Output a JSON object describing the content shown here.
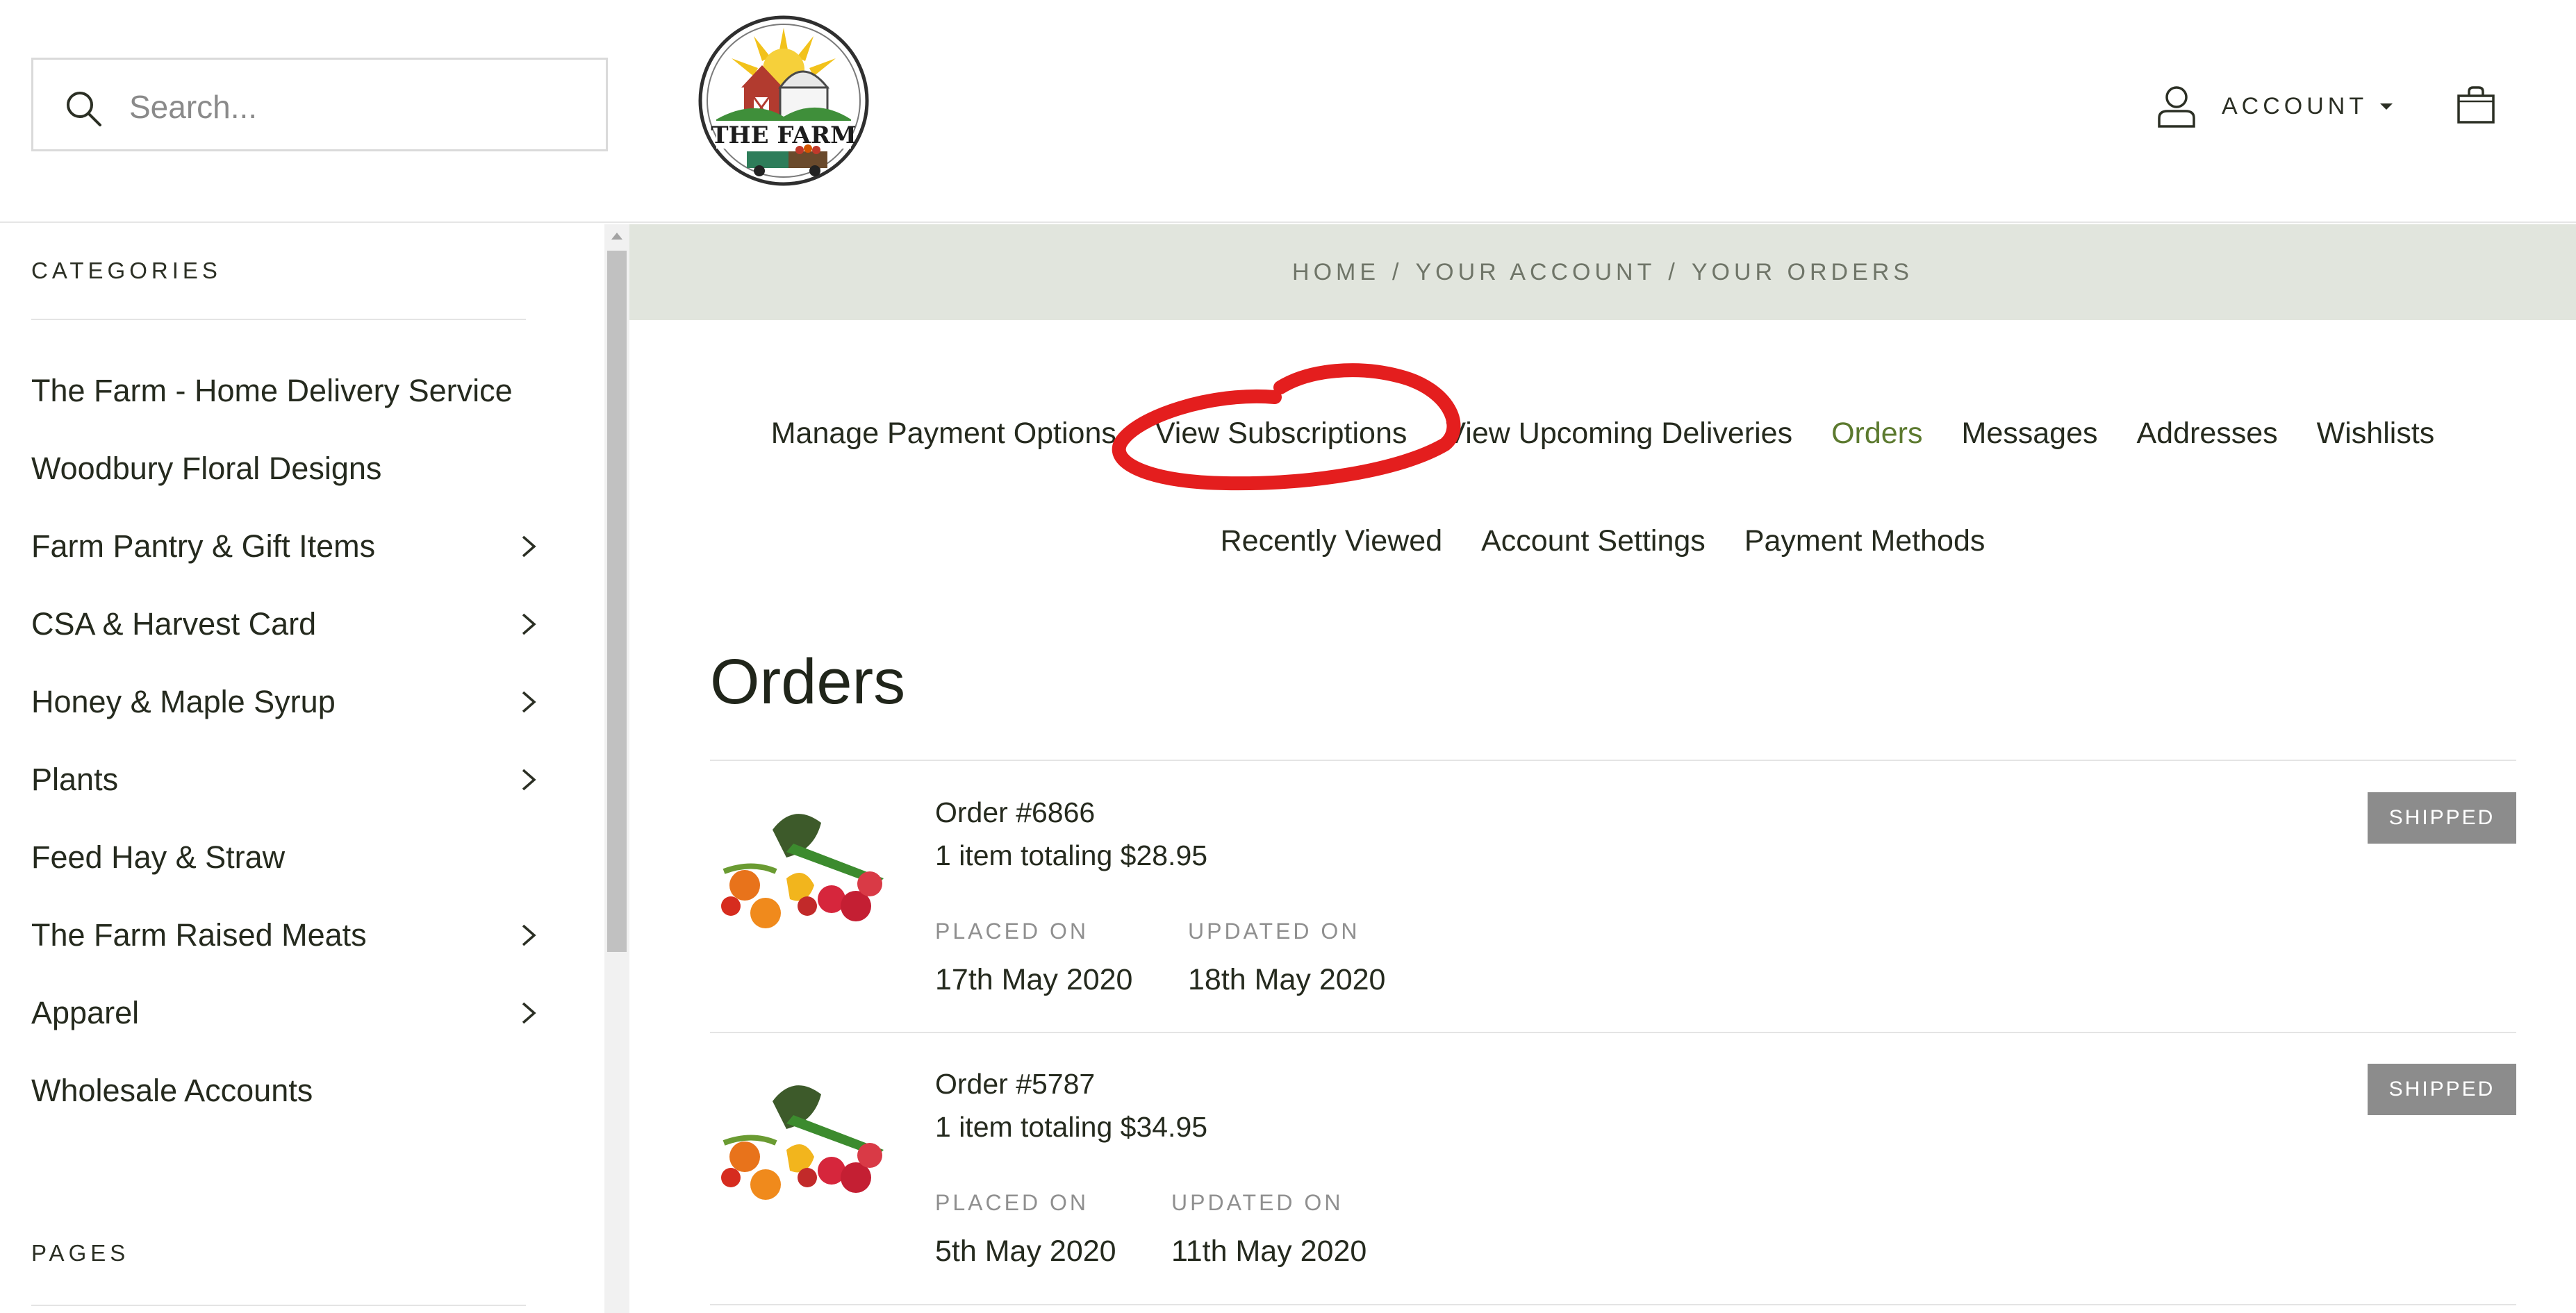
{
  "header": {
    "search_placeholder": "Search...",
    "account_label": "ACCOUNT"
  },
  "sidebar": {
    "categories_heading": "CATEGORIES",
    "pages_heading": "PAGES",
    "items": [
      {
        "label": "The Farm - Home Delivery Service",
        "has_children": false
      },
      {
        "label": "Woodbury Floral Designs",
        "has_children": false
      },
      {
        "label": "Farm Pantry & Gift Items",
        "has_children": true
      },
      {
        "label": "CSA & Harvest Card",
        "has_children": true
      },
      {
        "label": "Honey & Maple Syrup",
        "has_children": true
      },
      {
        "label": "Plants",
        "has_children": true
      },
      {
        "label": "Feed Hay & Straw",
        "has_children": false
      },
      {
        "label": "The Farm Raised Meats",
        "has_children": true
      },
      {
        "label": "Apparel",
        "has_children": true
      },
      {
        "label": "Wholesale Accounts",
        "has_children": false
      }
    ]
  },
  "breadcrumb": {
    "home": "HOME",
    "separator": "/",
    "account": "YOUR ACCOUNT",
    "current": "YOUR ORDERS"
  },
  "account_nav": {
    "row1": [
      "Manage Payment Options",
      "View Subscriptions",
      "View Upcoming Deliveries",
      "Orders",
      "Messages",
      "Addresses",
      "Wishlists"
    ],
    "row2": [
      "Recently Viewed",
      "Account Settings",
      "Payment Methods"
    ],
    "active": "Orders"
  },
  "main": {
    "title": "Orders",
    "orders": [
      {
        "number": "Order #6866",
        "summary": "1 item totaling $28.95",
        "placed_label": "PLACED ON",
        "placed_date": "17th May 2020",
        "updated_label": "UPDATED ON",
        "updated_date": "18th May 2020",
        "status": "SHIPPED"
      },
      {
        "number": "Order #5787",
        "summary": "1 item totaling $34.95",
        "placed_label": "PLACED ON",
        "placed_date": "5th May 2020",
        "updated_label": "UPDATED ON",
        "updated_date": "11th May 2020",
        "status": "SHIPPED"
      }
    ]
  },
  "colors": {
    "accent_green": "#5c7a2f",
    "crumb_band": "#e1e5dd",
    "status_badge": "#8c8c8c",
    "annotation_red": "#e41e1e"
  },
  "icons": [
    "search-icon",
    "user-icon",
    "shopping-bag-icon",
    "chevron-right-icon",
    "farm-logo"
  ]
}
